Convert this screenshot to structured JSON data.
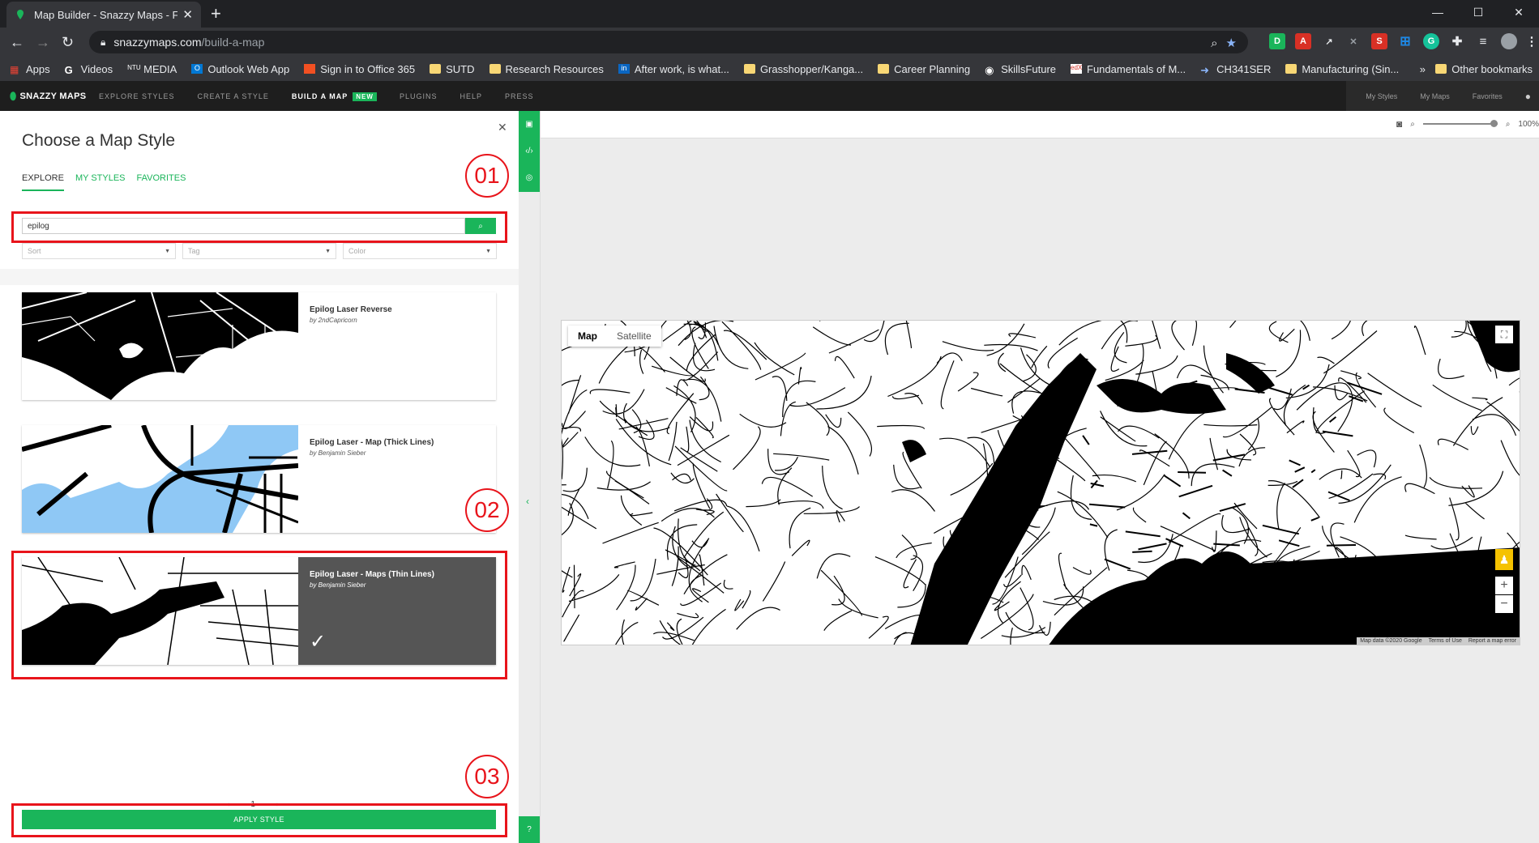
{
  "browser": {
    "tab_title": "Map Builder - Snazzy Maps - Free",
    "url_host": "snazzymaps.com",
    "url_path": "/build-a-map",
    "bookmarks": [
      {
        "label": "Apps",
        "icon": "apps-grid-icon"
      },
      {
        "label": "Videos",
        "icon": "google-icon"
      },
      {
        "label": "MEDIA",
        "icon": "ntu-icon"
      },
      {
        "label": "Outlook Web App",
        "icon": "outlook-icon"
      },
      {
        "label": "Sign in to Office 365",
        "icon": "office-icon"
      },
      {
        "label": "SUTD",
        "icon": "folder-icon"
      },
      {
        "label": "Research Resources",
        "icon": "folder-icon"
      },
      {
        "label": "After work, is what...",
        "icon": "linkedin-icon"
      },
      {
        "label": "Grasshopper/Kanga...",
        "icon": "folder-icon"
      },
      {
        "label": "Career Planning",
        "icon": "folder-icon"
      },
      {
        "label": "SkillsFuture",
        "icon": "globe-icon"
      },
      {
        "label": "Fundamentals of M...",
        "icon": "edx-icon"
      },
      {
        "label": "CH341SER",
        "icon": "link-icon"
      },
      {
        "label": "Manufacturing (Sin...",
        "icon": "folder-icon"
      }
    ],
    "other_bookmarks": "Other bookmarks",
    "more_bookmarks": "»"
  },
  "site_nav": {
    "logo": "SNAZZY MAPS",
    "items": [
      "EXPLORE STYLES",
      "CREATE A STYLE",
      "BUILD A MAP",
      "PLUGINS",
      "HELP",
      "PRESS"
    ],
    "new_badge": "NEW",
    "account_links": [
      "My Styles",
      "My Maps",
      "Favorites"
    ]
  },
  "panel": {
    "title": "Choose a Map Style",
    "tabs": [
      "EXPLORE",
      "MY STYLES",
      "FAVORITES"
    ],
    "search_value": "epilog",
    "filters": [
      "Sort",
      "Tag",
      "Color"
    ],
    "results": [
      {
        "name": "Epilog Laser Reverse",
        "author": "by 2ndCapricorn"
      },
      {
        "name": "Epilog Laser - Map (Thick Lines)",
        "author": "by Benjamin Sieber"
      },
      {
        "name": "Epilog Laser - Maps (Thin Lines)",
        "author": "by Benjamin Sieber",
        "selected": true
      }
    ],
    "pager": {
      "prev": "‹",
      "page": "1",
      "next": "›"
    },
    "apply_label": "APPLY STYLE"
  },
  "annotations": [
    "01",
    "02",
    "03"
  ],
  "map_toolbar": {
    "zoom_level": "100%",
    "zoom_fraction": 1.0
  },
  "map": {
    "types": [
      "Map",
      "Satellite"
    ],
    "attribution": [
      "Map data ©2020 Google",
      "Terms of Use",
      "Report a map error"
    ]
  },
  "colors": {
    "accent": "#1ab55a",
    "annotation_red": "#e8141b",
    "water_blue": "#8fc8f5"
  }
}
